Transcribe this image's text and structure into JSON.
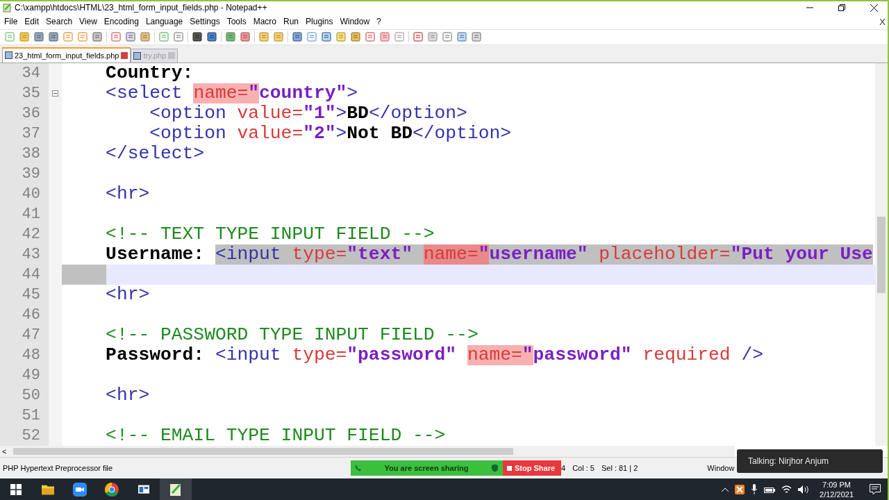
{
  "window": {
    "title": "C:\\xampp\\htdocs\\HTML\\23_html_form_input_fields.php - Notepad++",
    "close_doc": "X"
  },
  "menu": [
    "File",
    "Edit",
    "Search",
    "View",
    "Encoding",
    "Language",
    "Settings",
    "Tools",
    "Macro",
    "Run",
    "Plugins",
    "Window",
    "?"
  ],
  "tabs": [
    {
      "label": "23_html_form_input_fields.php",
      "selected": true
    },
    {
      "label": "try.php",
      "selected": false
    }
  ],
  "editor": {
    "lines": [
      {
        "number": "34",
        "fold_marker": false,
        "current": false,
        "selection_tail": false,
        "tokens": [
          {
            "kind": "text",
            "text": "    Country:",
            "selected": false,
            "matched": false
          }
        ]
      },
      {
        "number": "35",
        "fold_marker": true,
        "current": false,
        "selection_tail": false,
        "tokens": [
          {
            "kind": "tag",
            "text": "    <select ",
            "selected": false,
            "matched": false
          },
          {
            "kind": "attr",
            "text": "name=",
            "selected": false,
            "matched": true
          },
          {
            "kind": "str",
            "text": "\"",
            "selected": false,
            "matched": true
          },
          {
            "kind": "str",
            "text": "country\"",
            "selected": false,
            "matched": false
          },
          {
            "kind": "tag",
            "text": ">",
            "selected": false,
            "matched": false
          }
        ]
      },
      {
        "number": "36",
        "fold_marker": false,
        "current": false,
        "selection_tail": false,
        "tokens": [
          {
            "kind": "tag",
            "text": "        <option",
            "selected": false,
            "matched": false
          },
          {
            "kind": "attr",
            "text": " value=",
            "selected": false,
            "matched": false
          },
          {
            "kind": "str",
            "text": "\"1\"",
            "selected": false,
            "matched": false
          },
          {
            "kind": "tag",
            "text": ">",
            "selected": false,
            "matched": false
          },
          {
            "kind": "text",
            "text": "BD",
            "selected": false,
            "matched": false
          },
          {
            "kind": "tag",
            "text": "</option>",
            "selected": false,
            "matched": false
          }
        ]
      },
      {
        "number": "37",
        "fold_marker": false,
        "current": false,
        "selection_tail": false,
        "tokens": [
          {
            "kind": "tag",
            "text": "        <option",
            "selected": false,
            "matched": false
          },
          {
            "kind": "attr",
            "text": " value=",
            "selected": false,
            "matched": false
          },
          {
            "kind": "str",
            "text": "\"2\"",
            "selected": false,
            "matched": false
          },
          {
            "kind": "tag",
            "text": ">",
            "selected": false,
            "matched": false
          },
          {
            "kind": "text",
            "text": "Not BD",
            "selected": false,
            "matched": false
          },
          {
            "kind": "tag",
            "text": "</option>",
            "selected": false,
            "matched": false
          }
        ]
      },
      {
        "number": "38",
        "fold_marker": false,
        "current": false,
        "selection_tail": false,
        "tokens": [
          {
            "kind": "tag",
            "text": "    </select>",
            "selected": false,
            "matched": false
          }
        ]
      },
      {
        "number": "39",
        "fold_marker": false,
        "current": false,
        "selection_tail": false
      },
      {
        "number": "40",
        "fold_marker": false,
        "current": false,
        "selection_tail": false,
        "tokens": [
          {
            "kind": "tag",
            "text": "    <hr>",
            "selected": false,
            "matched": false
          }
        ]
      },
      {
        "number": "41",
        "fold_marker": false,
        "current": false,
        "selection_tail": false
      },
      {
        "number": "42",
        "fold_marker": false,
        "current": false,
        "selection_tail": false,
        "tokens": [
          {
            "kind": "comment",
            "text": "    <!-- TEXT TYPE INPUT FIELD -->",
            "selected": false,
            "matched": false
          }
        ]
      },
      {
        "number": "43",
        "fold_marker": false,
        "current": false,
        "selection_tail": false,
        "tokens": [
          {
            "kind": "text",
            "text": "    Username: ",
            "selected": false,
            "matched": false
          },
          {
            "kind": "tag",
            "text": "<input",
            "selected": true,
            "matched": false
          },
          {
            "kind": "attr",
            "text": " type=",
            "selected": true,
            "matched": false
          },
          {
            "kind": "str",
            "text": "\"text\" ",
            "selected": true,
            "matched": false
          },
          {
            "kind": "attr",
            "text": "name=",
            "selected": true,
            "matched": true
          },
          {
            "kind": "str",
            "text": "\"",
            "selected": true,
            "matched": true
          },
          {
            "kind": "str",
            "text": "username\"",
            "selected": true,
            "matched": false
          },
          {
            "kind": "attr",
            "text": " placeholder=",
            "selected": true,
            "matched": false
          },
          {
            "kind": "str",
            "text": "\"Put your Use",
            "selected": true,
            "matched": false
          }
        ]
      },
      {
        "number": "44",
        "fold_marker": false,
        "current": true,
        "selection_tail": true
      },
      {
        "number": "45",
        "fold_marker": false,
        "current": false,
        "selection_tail": false,
        "tokens": [
          {
            "kind": "tag",
            "text": "    <hr>",
            "selected": false,
            "matched": false
          }
        ]
      },
      {
        "number": "46",
        "fold_marker": false,
        "current": false,
        "selection_tail": false
      },
      {
        "number": "47",
        "fold_marker": false,
        "current": false,
        "selection_tail": false,
        "tokens": [
          {
            "kind": "comment",
            "text": "    <!-- PASSWORD TYPE INPUT FIELD -->",
            "selected": false,
            "matched": false
          }
        ]
      },
      {
        "number": "48",
        "fold_marker": false,
        "current": false,
        "selection_tail": false,
        "tokens": [
          {
            "kind": "text",
            "text": "    Password: ",
            "selected": false,
            "matched": false
          },
          {
            "kind": "tag",
            "text": "<input",
            "selected": false,
            "matched": false
          },
          {
            "kind": "attr",
            "text": " type=",
            "selected": false,
            "matched": false
          },
          {
            "kind": "str",
            "text": "\"password\" ",
            "selected": false,
            "matched": false
          },
          {
            "kind": "attr",
            "text": "name=",
            "selected": false,
            "matched": true
          },
          {
            "kind": "str",
            "text": "\"",
            "selected": false,
            "matched": true
          },
          {
            "kind": "str",
            "text": "password\"",
            "selected": false,
            "matched": false
          },
          {
            "kind": "attr",
            "text": " required",
            "selected": false,
            "matched": false
          },
          {
            "kind": "tag",
            "text": " />",
            "selected": false,
            "matched": false
          }
        ]
      },
      {
        "number": "49",
        "fold_marker": false,
        "current": false,
        "selection_tail": false
      },
      {
        "number": "50",
        "fold_marker": false,
        "current": false,
        "selection_tail": false,
        "tokens": [
          {
            "kind": "tag",
            "text": "    <hr>",
            "selected": false,
            "matched": false
          }
        ]
      },
      {
        "number": "51",
        "fold_marker": false,
        "current": false,
        "selection_tail": false
      },
      {
        "number": "52",
        "fold_marker": false,
        "current": false,
        "selection_tail": false,
        "tokens": [
          {
            "kind": "comment",
            "text": "    <!-- EMAIL TYPE INPUT FIELD -->",
            "selected": false,
            "matched": false
          }
        ]
      }
    ],
    "scroll_left": "<"
  },
  "status_bar": {
    "file_type": "PHP Hypertext Preprocessor file",
    "fields": [
      "4",
      "Col : 5",
      "Sel : 81 | 2",
      "Window"
    ]
  },
  "screen_share": {
    "message": "You are screen sharing",
    "stop": "Stop Share",
    "talking": "Talking: Nirjhor Anjum"
  },
  "taskbar": {
    "time": "7:09 PM",
    "date": "2/12/2021"
  }
}
